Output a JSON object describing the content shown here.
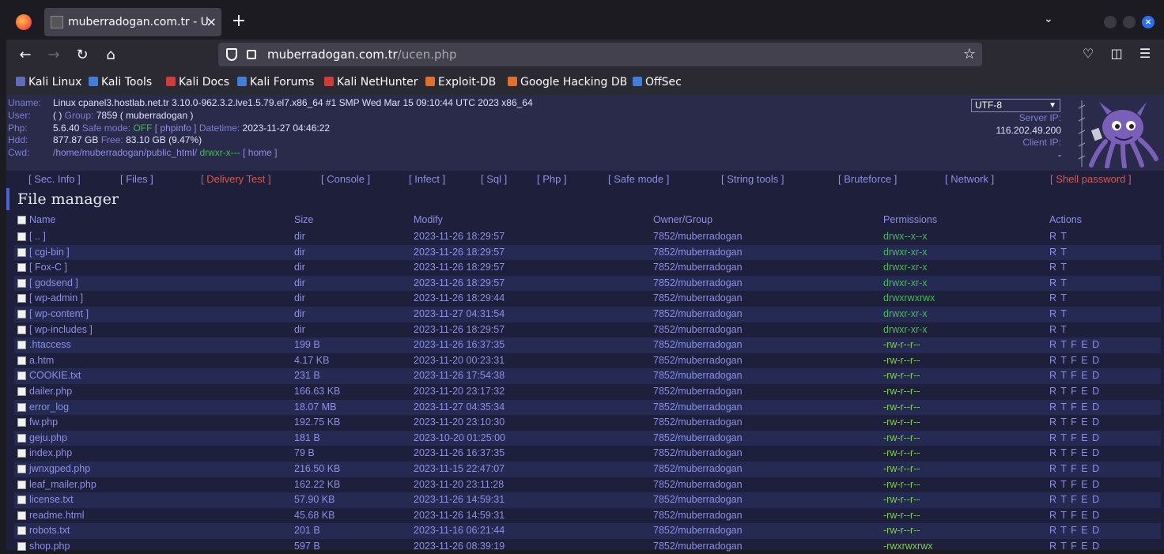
{
  "browser": {
    "tab_title": "muberradogan.com.tr - U",
    "tab_close": "×",
    "new_tab": "+",
    "url_domain": "muberradogan.com.tr",
    "url_path": "/ucen.php",
    "bookmarks": [
      "Kali Linux",
      "Kali Tools",
      "Kali Docs",
      "Kali Forums",
      "Kali NetHunter",
      "Exploit-DB",
      "Google Hacking DB",
      "OffSec"
    ]
  },
  "info": {
    "uname_label": "Uname:",
    "uname_value": "Linux cpanel3.hostlab.net.tr 3.10.0-962.3.2.lve1.5.79.el7.x86_64 #1 SMP Wed Mar 15 09:10:44 UTC 2023 x86_64",
    "user_label": "User:",
    "user_value": "( )",
    "group_label": "Group:",
    "group_value": "7859 ( muberradogan )",
    "php_label": "Php:",
    "php_value": "5.6.40",
    "safe_mode_label": "Safe mode:",
    "safe_mode_value": "OFF",
    "phpinfo_link": "[ phpinfo ]",
    "datetime_label": "Datetime:",
    "datetime_value": "2023-11-27 04:46:22",
    "hdd_label": "Hdd:",
    "hdd_value": "877.87 GB",
    "free_label": "Free:",
    "free_value": "83.10 GB (9.47%)",
    "cwd_label": "Cwd:",
    "cwd_value": "/home/muberradogan/public_html/",
    "cwd_perms": "drwxr-x---",
    "home_link": "[ home ]"
  },
  "server": {
    "charset": "UTF-8",
    "server_ip_label": "Server IP:",
    "server_ip_value": "116.202.49.200",
    "client_ip_label": "Client IP:",
    "client_ip_value": "-"
  },
  "menu": [
    "[ Sec. Info ]",
    "[ Files ]",
    "[ Delivery Test ]",
    "[ Console ]",
    "[ Infect ]",
    "[ Sql ]",
    "[ Php ]",
    "[ Safe mode ]",
    "[ String tools ]",
    "[ Bruteforce ]",
    "[ Network ]",
    "[ Shell password ]"
  ],
  "file_manager": {
    "title": "File manager",
    "columns": [
      "Name",
      "Size",
      "Modify",
      "Owner/Group",
      "Permissions",
      "Actions"
    ],
    "rows": [
      {
        "name": "[ .. ]",
        "size": "dir",
        "modify": "2023-11-26 18:29:57",
        "owner": "7852/muberradogan",
        "perms": "drwx--x--x",
        "actions": "R T"
      },
      {
        "name": "[ cgi-bin ]",
        "size": "dir",
        "modify": "2023-11-26 18:29:57",
        "owner": "7852/muberradogan",
        "perms": "drwxr-xr-x",
        "actions": "R T"
      },
      {
        "name": "[ Fox-C ]",
        "size": "dir",
        "modify": "2023-11-26 18:29:57",
        "owner": "7852/muberradogan",
        "perms": "drwxr-xr-x",
        "actions": "R T"
      },
      {
        "name": "[ godsend ]",
        "size": "dir",
        "modify": "2023-11-26 18:29:57",
        "owner": "7852/muberradogan",
        "perms": "drwxr-xr-x",
        "actions": "R T"
      },
      {
        "name": "[ wp-admin ]",
        "size": "dir",
        "modify": "2023-11-26 18:29:44",
        "owner": "7852/muberradogan",
        "perms": "drwxrwxrwx",
        "actions": "R T"
      },
      {
        "name": "[ wp-content ]",
        "size": "dir",
        "modify": "2023-11-27 04:31:54",
        "owner": "7852/muberradogan",
        "perms": "drwxr-xr-x",
        "actions": "R T"
      },
      {
        "name": "[ wp-includes ]",
        "size": "dir",
        "modify": "2023-11-26 18:29:57",
        "owner": "7852/muberradogan",
        "perms": "drwxr-xr-x",
        "actions": "R T"
      },
      {
        "name": ".htaccess",
        "size": "199 B",
        "modify": "2023-11-26 16:37:35",
        "owner": "7852/muberradogan",
        "perms": "-rw-r--r--",
        "actions": "R T F E D"
      },
      {
        "name": "a.htm",
        "size": "4.17 KB",
        "modify": "2023-11-20 00:23:31",
        "owner": "7852/muberradogan",
        "perms": "-rw-r--r--",
        "actions": "R T F E D"
      },
      {
        "name": "COOKIE.txt",
        "size": "231 B",
        "modify": "2023-11-26 17:54:38",
        "owner": "7852/muberradogan",
        "perms": "-rw-r--r--",
        "actions": "R T F E D"
      },
      {
        "name": "dailer.php",
        "size": "166.63 KB",
        "modify": "2023-11-20 23:17:32",
        "owner": "7852/muberradogan",
        "perms": "-rw-r--r--",
        "actions": "R T F E D"
      },
      {
        "name": "error_log",
        "size": "18.07 MB",
        "modify": "2023-11-27 04:35:34",
        "owner": "7852/muberradogan",
        "perms": "-rw-r--r--",
        "actions": "R T F E D"
      },
      {
        "name": "fw.php",
        "size": "192.75 KB",
        "modify": "2023-11-20 23:10:30",
        "owner": "7852/muberradogan",
        "perms": "-rw-r--r--",
        "actions": "R T F E D"
      },
      {
        "name": "geju.php",
        "size": "181 B",
        "modify": "2023-10-20 01:25:00",
        "owner": "7852/muberradogan",
        "perms": "-rw-r--r--",
        "actions": "R T F E D"
      },
      {
        "name": "index.php",
        "size": "79 B",
        "modify": "2023-11-26 16:37:35",
        "owner": "7852/muberradogan",
        "perms": "-rw-r--r--",
        "actions": "R T F E D"
      },
      {
        "name": "jwnxgped.php",
        "size": "216.50 KB",
        "modify": "2023-11-15 22:47:07",
        "owner": "7852/muberradogan",
        "perms": "-rw-r--r--",
        "actions": "R T F E D"
      },
      {
        "name": "leaf_mailer.php",
        "size": "162.22 KB",
        "modify": "2023-11-20 23:11:28",
        "owner": "7852/muberradogan",
        "perms": "-rw-r--r--",
        "actions": "R T F E D"
      },
      {
        "name": "license.txt",
        "size": "57.90 KB",
        "modify": "2023-11-26 14:59:31",
        "owner": "7852/muberradogan",
        "perms": "-rw-r--r--",
        "actions": "R T F E D"
      },
      {
        "name": "readme.html",
        "size": "45.68 KB",
        "modify": "2023-11-26 14:59:31",
        "owner": "7852/muberradogan",
        "perms": "-rw-r--r--",
        "actions": "R T F E D"
      },
      {
        "name": "robots.txt",
        "size": "201 B",
        "modify": "2023-11-16 06:21:44",
        "owner": "7852/muberradogan",
        "perms": "-rw-r--r--",
        "actions": "R T F E D"
      },
      {
        "name": "shop.php",
        "size": "597 B",
        "modify": "2023-11-26 08:39:19",
        "owner": "7852/muberradogan",
        "perms": "-rwxrwxrwx",
        "actions": "R T F E D"
      }
    ]
  }
}
